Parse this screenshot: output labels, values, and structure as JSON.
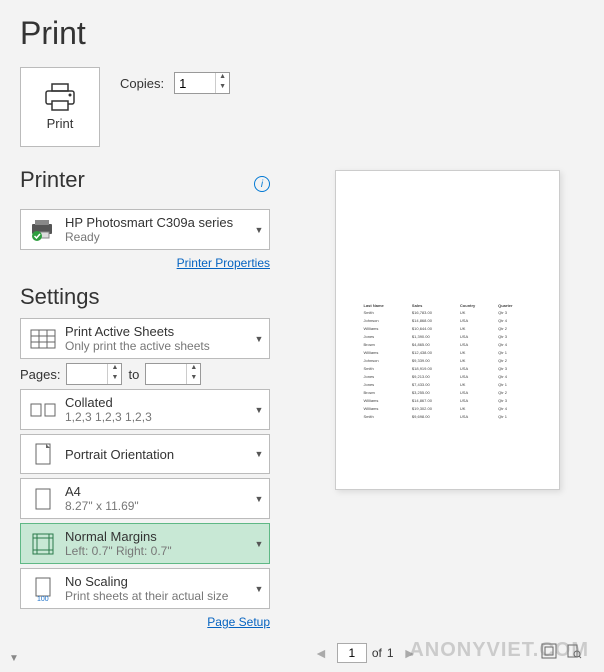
{
  "title": "Print",
  "print_button_label": "Print",
  "copies": {
    "label": "Copies:",
    "value": "1"
  },
  "printer": {
    "section_title": "Printer",
    "name": "HP Photosmart C309a series",
    "status": "Ready",
    "properties_link": "Printer Properties"
  },
  "settings": {
    "section_title": "Settings",
    "scope": {
      "title": "Print Active Sheets",
      "sub": "Only print the active sheets"
    },
    "pages": {
      "label": "Pages:",
      "from": "",
      "to_label": "to",
      "to": ""
    },
    "collate": {
      "title": "Collated",
      "sub": "1,2,3    1,2,3    1,2,3"
    },
    "orientation": {
      "title": "Portrait Orientation"
    },
    "paper": {
      "title": "A4",
      "sub": "8.27\" x 11.69\""
    },
    "margins": {
      "title": "Normal Margins",
      "sub": "Left:  0.7\"    Right:  0.7\""
    },
    "scaling": {
      "title": "No Scaling",
      "sub": "Print sheets at their actual size"
    },
    "page_setup_link": "Page Setup"
  },
  "preview": {
    "current_page": "1",
    "total_pages": "1",
    "of_label": "of",
    "headers": [
      "Last Name",
      "Sales",
      "Country",
      "Quarter"
    ],
    "rows": [
      [
        "Smith",
        "$16,783.00",
        "UK",
        "Qtr 3"
      ],
      [
        "Johnson",
        "$14,868.00",
        "USA",
        "Qtr 4"
      ],
      [
        "Williams",
        "$10,644.00",
        "UK",
        "Qtr 2"
      ],
      [
        "Jones",
        "$1,390.00",
        "USA",
        "Qtr 3"
      ],
      [
        "Brown",
        "$4,865.00",
        "USA",
        "Qtr 4"
      ],
      [
        "Williams",
        "$12,438.00",
        "UK",
        "Qtr 1"
      ],
      [
        "Johnson",
        "$9,339.00",
        "UK",
        "Qtr 2"
      ],
      [
        "Smith",
        "$18,919.00",
        "USA",
        "Qtr 3"
      ],
      [
        "Jones",
        "$9,213.00",
        "USA",
        "Qtr 4"
      ],
      [
        "Jones",
        "$7,433.00",
        "UK",
        "Qtr 1"
      ],
      [
        "Brown",
        "$3,255.00",
        "USA",
        "Qtr 2"
      ],
      [
        "Williams",
        "$14,867.00",
        "USA",
        "Qtr 3"
      ],
      [
        "Williams",
        "$19,302.00",
        "UK",
        "Qtr 4"
      ],
      [
        "Smith",
        "$9,698.00",
        "USA",
        "Qtr 1"
      ]
    ]
  },
  "watermark": "ANONYVIET.COM"
}
